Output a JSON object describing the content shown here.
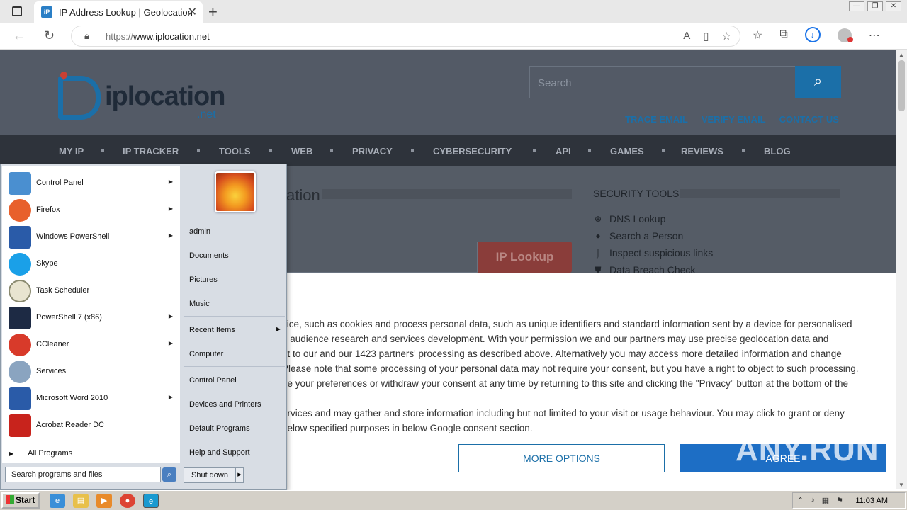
{
  "browser": {
    "tab_title": "IP Address Lookup | Geolocation",
    "url_proto": "https://",
    "url_host": "www.iplocation.net"
  },
  "site": {
    "logo_name": "iplocation",
    "logo_tld": ".net",
    "search_placeholder": "Search",
    "top_links": [
      "TRACE EMAIL",
      "VERIFY EMAIL",
      "CONTACT US"
    ],
    "nav": [
      "MY IP",
      "IP TRACKER",
      "TOOLS",
      "WEB",
      "PRIVACY",
      "CYBERSECURITY",
      "API",
      "GAMES",
      "REVIEWS",
      "BLOG"
    ],
    "heading_fragment": "ation",
    "lookup_button": "IP Lookup",
    "security_title": "SECURITY TOOLS",
    "security_items": [
      "DNS Lookup",
      "Search a Person",
      "Inspect suspicious links",
      "Data Breach Check"
    ]
  },
  "consent": {
    "lines": [
      "vice, such as cookies and process personal data, such as unique identifiers and standard information sent by a device for personalised",
      "t, audience research and services development. With your permission we and our partners may use precise geolocation data and",
      "nt to our and our 1423 partners' processing as described above. Alternatively you may access more detailed information and change",
      "Please note that some processing of your personal data may not require your consent, but you have a right to object to such processing.",
      "ge your preferences or withdraw your consent at any time by returning to this site and clicking the \"Privacy\" button at the bottom of the",
      "",
      "ervices and may gather and store information including but not limited to your visit or usage behaviour. You may click to grant or deny",
      " below specified purposes in below Google consent section."
    ],
    "more_options": "MORE OPTIONS",
    "agree": "AGREE",
    "watermark": "ANY.RUN"
  },
  "start_menu": {
    "programs": [
      {
        "label": "Control Panel",
        "arrow": true,
        "color": "#4a8fd0"
      },
      {
        "label": "Firefox",
        "arrow": true,
        "color": "#e8602c"
      },
      {
        "label": "Windows PowerShell",
        "arrow": true,
        "color": "#2a5ba8"
      },
      {
        "label": "Skype",
        "arrow": false,
        "color": "#1aa0e8"
      },
      {
        "label": "Task Scheduler",
        "arrow": false,
        "color": "#c8c8b0"
      },
      {
        "label": "PowerShell 7 (x86)",
        "arrow": true,
        "color": "#1d2a44"
      },
      {
        "label": "CCleaner",
        "arrow": true,
        "color": "#d83a2a"
      },
      {
        "label": "Services",
        "arrow": false,
        "color": "#8aa4c0"
      },
      {
        "label": "Microsoft Word 2010",
        "arrow": true,
        "color": "#2a5ba8"
      },
      {
        "label": "Acrobat Reader DC",
        "arrow": false,
        "color": "#c8231c"
      }
    ],
    "all_programs": "All Programs",
    "search_placeholder": "Search programs and files",
    "right_items": {
      "user": "admin",
      "documents": "Documents",
      "pictures": "Pictures",
      "music": "Music",
      "recent": "Recent Items",
      "computer": "Computer",
      "control_panel": "Control Panel",
      "devices": "Devices and Printers",
      "defaults": "Default Programs",
      "help": "Help and Support"
    },
    "shutdown": "Shut down"
  },
  "taskbar": {
    "start": "Start",
    "time": "11:03 AM"
  }
}
